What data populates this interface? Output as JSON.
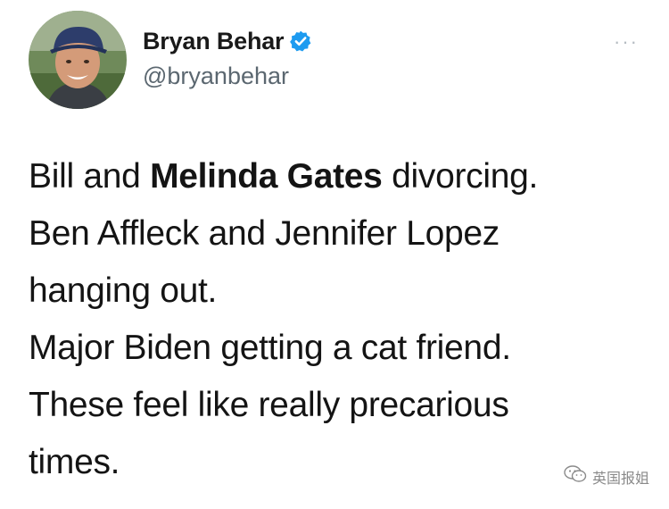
{
  "author": {
    "display_name": "Bryan Behar",
    "handle": "@bryanbehar",
    "verified": true,
    "avatar": "profile-photo"
  },
  "more_menu": {
    "label": "···",
    "icon": "more-options-icon"
  },
  "tweet": {
    "line1_pre": "Bill and ",
    "line1_bold": "Melinda Gates",
    "line1_post": " divorcing.",
    "line2": "Ben Affleck and Jennifer Lopez",
    "line3": "hanging out.",
    "line4": "Major Biden getting a cat friend.",
    "line5": "These feel like really precarious",
    "line6": "times."
  },
  "watermark": {
    "text": "英国报姐",
    "icon": "wechat-icon"
  },
  "colors": {
    "verified_badge": "#1d9bf0",
    "handle": "#5b6770",
    "text": "#141414"
  }
}
